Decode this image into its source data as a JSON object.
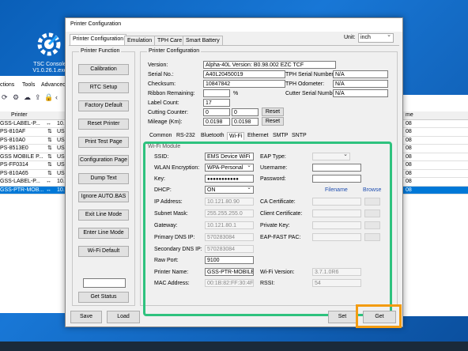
{
  "desktop": {
    "icon_label": "TSC Console V1.0.26.1.exe"
  },
  "bg_app": {
    "menu": [
      "ctions",
      "Tools",
      "Advanced"
    ],
    "column_header": "Printer",
    "rows": [
      {
        "name": "GSS-LABEL-P...",
        "port": "10."
      },
      {
        "name": "PS-810AF",
        "port": "US"
      },
      {
        "name": "PS-810A0",
        "port": "US"
      },
      {
        "name": "PS-8513E0",
        "port": "US"
      },
      {
        "name": "GSS MOBILE P...",
        "port": "US"
      },
      {
        "name": "PS-FF0314",
        "port": "US"
      },
      {
        "name": "PS-810A65",
        "port": "US"
      },
      {
        "name": "GSS-LABEL-P...",
        "port": "10."
      },
      {
        "name": "GSS-PTR-MOB...",
        "port": "10."
      }
    ],
    "right_header": "me",
    "right_rows": [
      "08",
      "08",
      "08",
      "08",
      "08",
      "08",
      "08",
      "08",
      "08"
    ]
  },
  "dialog": {
    "title": "Printer Configuration",
    "tabs": [
      "Printer Configuration",
      "Emulation",
      "TPH Care",
      "Smart Battery"
    ],
    "unit_label": "Unit:",
    "unit_value": "inch",
    "printer_function": {
      "title": "Printer Function",
      "buttons": [
        "Calibration",
        "RTC Setup",
        "Factory Default",
        "Reset Printer",
        "Print Test Page",
        "Configuration Page",
        "Dump Text",
        "Ignore AUTO.BAS",
        "Exit Line Mode",
        "Enter Line Mode",
        "Wi-Fi Default"
      ],
      "get_status": "Get Status"
    },
    "printer_configuration": {
      "title": "Printer Configuration",
      "version_label": "Version:",
      "version": "Alpha-40L Version: B0.98.002 EZC TCF",
      "serial_label": "Serial No.:",
      "serial": "A40L20450019",
      "tph_serial_label": "TPH Serial Number:",
      "tph_serial": "N/A",
      "checksum_label": "Checksum:",
      "checksum": "10847842",
      "tph_odometer_label": "TPH Odometer:",
      "tph_odometer": "N/A",
      "ribbon_label": "Ribbon Remaining:",
      "ribbon_unit": "%",
      "cutter_serial_label": "Cutter Serial Number:",
      "cutter_serial": "N/A",
      "label_count_label": "Label Count:",
      "label_count": "17",
      "cutting_counter_label": "Cutting Counter:",
      "cutting_counter": "0",
      "cutting_counter_2": "0",
      "mileage_label": "Mileage (Km):",
      "mileage": "0.0198",
      "mileage_2": "0.0198",
      "reset": "Reset"
    },
    "subtabs": [
      "Common",
      "RS-232",
      "Bluetooth",
      "Wi-Fi",
      "Ethernet",
      "SMTP",
      "SNTP"
    ],
    "wifi": {
      "title": "Wi-Fi Module",
      "ssid_label": "SSID:",
      "ssid": "EMS Device WiFi",
      "encryption_label": "WLAN Encryption:",
      "encryption": "WPA-Personal",
      "key_label": "Key:",
      "key": "●●●●●●●●●●●",
      "dhcp_label": "DHCP:",
      "dhcp": "ON",
      "ip_label": "IP Address:",
      "ip": "10.121.80.90",
      "subnet_label": "Subnet Mask:",
      "subnet": "255.255.255.0",
      "gateway_label": "Gateway:",
      "gateway": "10.121.80.1",
      "dns1_label": "Primary DNS IP:",
      "dns1": "570283084",
      "dns2_label": "Secondary DNS IP:",
      "dns2": "570283084",
      "raw_port_label": "Raw Port:",
      "raw_port": "9100",
      "printer_name_label": "Printer Name:",
      "printer_name": "GSS-PTR-MOBILE",
      "mac_label": "MAC Address:",
      "mac": "00:1B:82:FF:30:4F",
      "eap_type_label": "EAP Type:",
      "username_label": "Username:",
      "password_label": "Password:",
      "filename_header": "Filename",
      "browse_header": "Browse",
      "ca_cert_label": "CA Certificate:",
      "client_cert_label": "Client Certificate:",
      "private_key_label": "Private Key:",
      "eap_fast_label": "EAP-FAST PAC:",
      "wifi_version_label": "Wi-Fi Version:",
      "wifi_version": "3.7.1.0R6",
      "rssi_label": "RSSI:",
      "rssi": "54"
    },
    "footer": {
      "save": "Save",
      "load": "Load",
      "set": "Set",
      "get": "Get"
    }
  },
  "colors": {
    "highlight_green": "#2ec27e",
    "highlight_orange": "#f39c12",
    "selection": "#0078d7"
  }
}
